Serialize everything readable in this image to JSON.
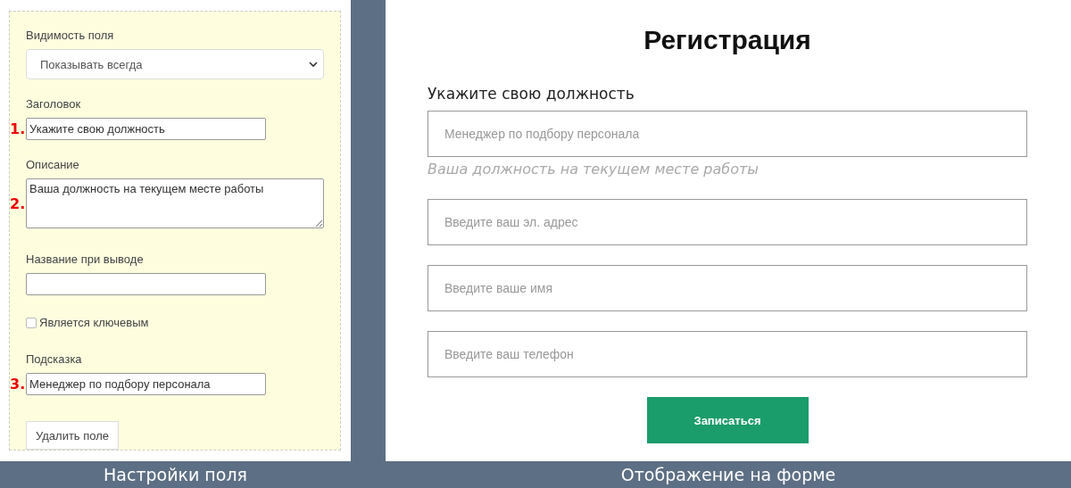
{
  "settings": {
    "fields": [
      {
        "kind": "select",
        "label": "Видимость поля",
        "value": "Показывать всегда"
      },
      {
        "kind": "text",
        "label": "Заголовок",
        "value": "Укажите свою должность",
        "marker": "1."
      },
      {
        "kind": "textarea",
        "label": "Описание",
        "value": "Ваша должность на текущем месте работы",
        "marker": "2."
      },
      {
        "kind": "text",
        "label": "Название при выводе"
      },
      {
        "kind": "checkbox",
        "label": "Является ключевым",
        "checked": false
      },
      {
        "kind": "text",
        "label": "Подсказка",
        "value": "Менеджер по подбору персонала",
        "marker": "3."
      }
    ],
    "delete_button": "Удалить поле"
  },
  "preview": {
    "title": "Регистрация",
    "field_label": "Укажите свою должность",
    "fields": [
      {
        "placeholder": "Менеджер по подбору персонала",
        "description": "Ваша должность на текущем месте работы"
      },
      {
        "placeholder": "Введите ваш эл. адрес"
      },
      {
        "placeholder": "Введите ваше имя"
      },
      {
        "placeholder": "Введите ваш телефон"
      }
    ],
    "submit_button": "Записаться"
  },
  "captions": [
    "Настройки поля",
    "Отображение на форме"
  ]
}
